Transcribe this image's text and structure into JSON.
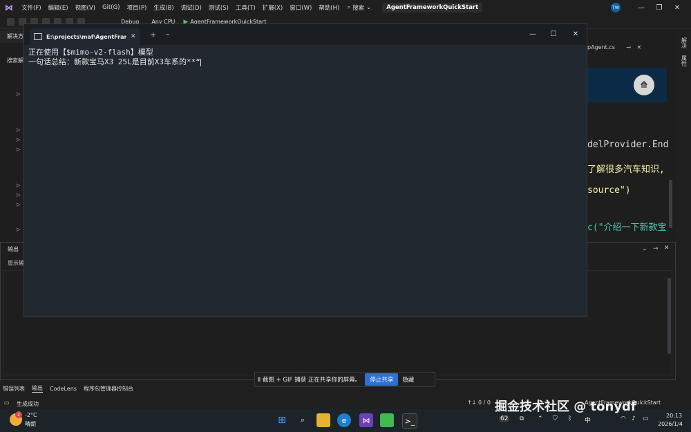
{
  "menubar": {
    "items": [
      "文件(F)",
      "编辑(E)",
      "视图(V)",
      "Git(G)",
      "项目(P)",
      "生成(B)",
      "调试(D)",
      "测试(S)",
      "工具(T)",
      "扩展(X)",
      "窗口(W)",
      "帮助(H)"
    ],
    "search": "搜索",
    "project_title": "AgentFrameworkQuickStart",
    "avatar": "TW"
  },
  "toolbar": {
    "config": "Debug",
    "platform": "Any CPU",
    "run_target": "AgentFrameworkQuickStart"
  },
  "solution_panel": {
    "header": "解决方",
    "search": "搜索解"
  },
  "editor": {
    "tab": "pAgent.cs",
    "lines": [
      "delProvider.End",
      "了解很多汽车知识,",
      "source\")",
      "c(\"介绍一下新款宝"
    ]
  },
  "right_vtabs": [
    "解决",
    "属性"
  ],
  "output_panel": {
    "title": "输出",
    "show_label": "显示输"
  },
  "bottom_tabs": [
    "错误列表",
    "输出",
    "CodeLens",
    "程序包管理器控制台"
  ],
  "status": {
    "text": "生成成功",
    "lines": "↑↓ 0 / 0",
    "project": "AgentFrameworkQuickStart"
  },
  "share_bar": {
    "text": "Ⅱ 截图 + GIF 捕获 正在共享你的屏幕。",
    "stop": "停止共享",
    "hide": "隐藏"
  },
  "terminal": {
    "tab_title": "E:\\projects\\maf\\AgentFramew",
    "lines": [
      "正在使用【$mimo-v2-flash】模型",
      "一句话总结：新款宝马X3 25L是目前X3车系的**“"
    ]
  },
  "taskbar": {
    "weather_temp": "-2°C",
    "weather_desc": "晴朗",
    "weather_badge": "2",
    "tray_badge": "62",
    "ime": "中",
    "time": "20:13",
    "date": "2026/1/4"
  },
  "watermark": "掘金技术社区 @ tonydf"
}
